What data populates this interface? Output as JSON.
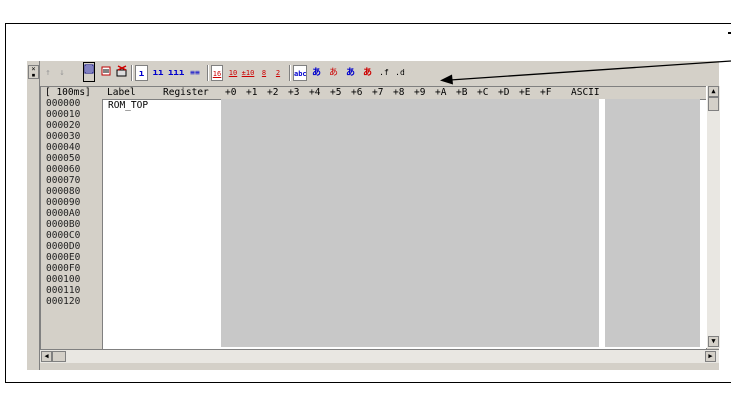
{
  "toolbar": {
    "icons": [
      "up-arrow-icon",
      "down-arrow-icon",
      "setup-icon",
      "refresh-icon",
      "cut-icon",
      "byte-icon",
      "word-icon",
      "lword-icon",
      "bit-icon",
      "hex16-icon",
      "dec10-icon",
      "signed-dec-icon",
      "octal-icon",
      "binary-icon",
      "ascii-icon",
      "sjis-icon",
      "jis-icon",
      "euc-icon",
      "unicode-icon",
      "float-icon",
      "double-icon"
    ],
    "labels": {
      "hex16": "16",
      "dec10": "10",
      "sdec": "±10",
      "oct": "8",
      "bin": "2",
      "abc": "abc",
      "a1": "あ",
      "a2": "あ",
      "a3": "あ",
      "a4": "あ",
      "f": ".f",
      "d": ".d"
    }
  },
  "grid": {
    "header": {
      "interval": "[ 100ms]",
      "label": "Label",
      "register": "Register",
      "cols": [
        "+0",
        "+1",
        "+2",
        "+3",
        "+4",
        "+5",
        "+6",
        "+7",
        "+8",
        "+9",
        "+A",
        "+B",
        "+C",
        "+D",
        "+E",
        "+F"
      ],
      "ascii": "ASCII"
    },
    "addresses": [
      "000000",
      "000010",
      "000020",
      "000030",
      "000040",
      "000050",
      "000060",
      "000070",
      "000080",
      "000090",
      "0000A0",
      "0000B0",
      "0000C0",
      "0000D0",
      "0000E0",
      "0000F0",
      "000100",
      "000110",
      "000120"
    ],
    "first_label": "ROM_TOP"
  }
}
